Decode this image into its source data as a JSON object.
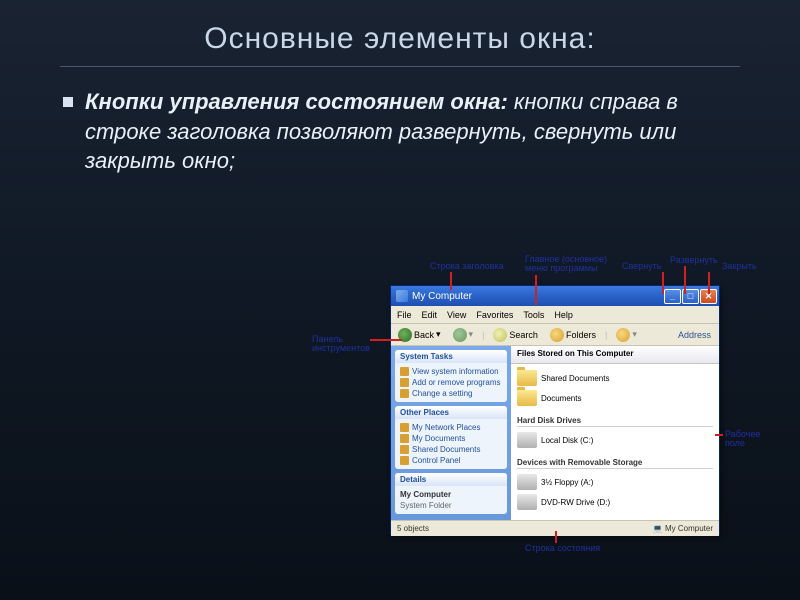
{
  "slide": {
    "title": "Основные элементы окна:",
    "bold_lead": "Кнопки управления состоянием окна:",
    "rest": " кнопки справа в строке заголовка позволяют развернуть, свернуть или закрыть окно;"
  },
  "annotations": {
    "titlebar": "Строка заголовка",
    "mainmenu": "Главное (основное)\nменю программы",
    "minimize": "Свернуть",
    "maximize": "Развернуть",
    "close": "Закрыть",
    "toolpanel": "Панель\nинструментов",
    "workarea": "Рабочее\nполе",
    "statusbar": "Строка состояния"
  },
  "window": {
    "title": "My Computer",
    "menubar": [
      "File",
      "Edit",
      "View",
      "Favorites",
      "Tools",
      "Help"
    ],
    "toolbar": {
      "back": "Back",
      "search": "Search",
      "folders": "Folders",
      "address_label": "Address"
    },
    "addressbar": "Files Stored on This Computer",
    "sidebar": {
      "system_tasks": {
        "head": "System Tasks",
        "items": [
          "View system information",
          "Add or remove programs",
          "Change a setting"
        ]
      },
      "other_places": {
        "head": "Other Places",
        "items": [
          "My Network Places",
          "My Documents",
          "Shared Documents",
          "Control Panel"
        ]
      },
      "details": {
        "head": "Details",
        "name": "My Computer",
        "type": "System Folder"
      }
    },
    "main": {
      "sec_files": {
        "label": "",
        "items": [
          "Shared Documents",
          "Documents"
        ]
      },
      "sec_hdd": {
        "label": "Hard Disk Drives",
        "items": [
          "Local Disk (C:)"
        ]
      },
      "sec_removable": {
        "label": "Devices with Removable Storage",
        "items": [
          "3½ Floppy (A:)",
          "DVD-RW Drive (D:)"
        ]
      }
    },
    "statusbar": {
      "objects": "5 objects",
      "location": "My Computer"
    }
  }
}
